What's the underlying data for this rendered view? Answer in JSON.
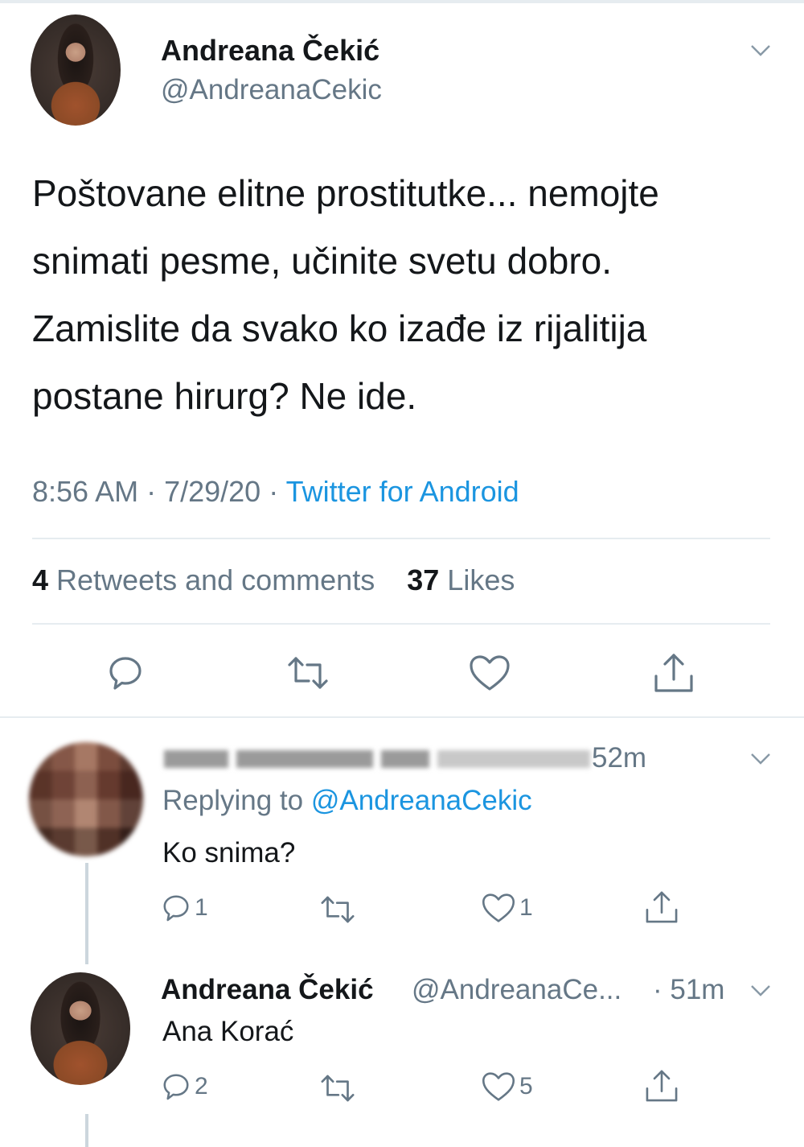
{
  "tweet": {
    "author_name": "Andreana Čekić",
    "author_handle": "@AndreanaCekic",
    "text_lines": [
      "Poštovane elitne prostitutke... nemojte",
      "snimati pesme, učinite svetu dobro.",
      "Zamislite da svako ko izađe iz rijalitija",
      "postane hirurg? Ne ide."
    ],
    "time": "8:56 AM",
    "date": "7/29/20",
    "separator": " · ",
    "source": "Twitter for Android",
    "retweets_count": "4",
    "retweets_label": " Retweets and comments",
    "likes_count": "37",
    "likes_label": " Likes"
  },
  "replies": [
    {
      "author_name": "",
      "time": "52m",
      "replying_label": "Replying to ",
      "replying_to": "@AndreanaCekic",
      "text": "Ko snima?",
      "reply_count": "1",
      "retweet_count": "",
      "like_count": "1"
    },
    {
      "author_name": "Andreana Čekić",
      "author_handle": "@AndreanaCe...",
      "time": "· 51m",
      "text": "Ana Korać",
      "reply_count": "2",
      "retweet_count": "",
      "like_count": "5"
    }
  ],
  "icons": {
    "reply": "reply-icon",
    "retweet": "retweet-icon",
    "like": "heart-icon",
    "share": "share-icon",
    "more": "chevron-down-icon"
  },
  "colors": {
    "link": "#1b95e0",
    "secondary_text": "#657786",
    "primary_text": "#14171a",
    "divider": "#e6ecf0"
  }
}
